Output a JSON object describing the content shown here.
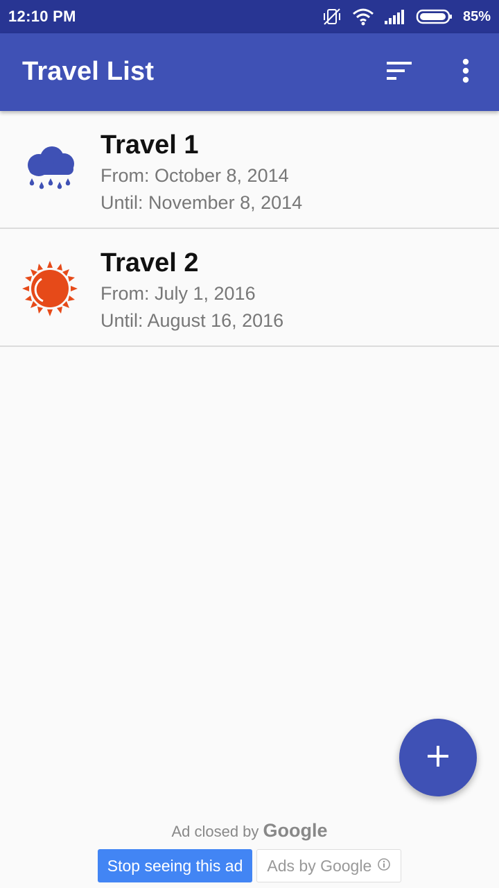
{
  "status_bar": {
    "time": "12:10 PM",
    "battery": "85%",
    "icons": [
      "vibrate-off-icon",
      "wifi-icon",
      "signal-icon",
      "battery-icon"
    ]
  },
  "app_bar": {
    "title": "Travel List",
    "actions": [
      "sort-icon",
      "more-vert-icon"
    ]
  },
  "travels": [
    {
      "title": "Travel 1",
      "from": "From: October 8, 2014",
      "until": "Until: November 8, 2014",
      "icon": "rain-cloud-icon"
    },
    {
      "title": "Travel 2",
      "from": "From: July 1, 2016",
      "until": "Until: August 16, 2016",
      "icon": "sun-icon"
    }
  ],
  "fab": {
    "icon": "add-icon"
  },
  "ad": {
    "closed_prefix": "Ad closed by",
    "closed_brand": "Google",
    "stop_label": "Stop seeing this ad",
    "ads_by_label": "Ads by Google"
  },
  "colors": {
    "status_bar": "#283593",
    "primary": "#3f51b5",
    "rain_icon": "#3f51b5",
    "sun_icon": "#e64a19",
    "ad_button": "#4285f4"
  }
}
